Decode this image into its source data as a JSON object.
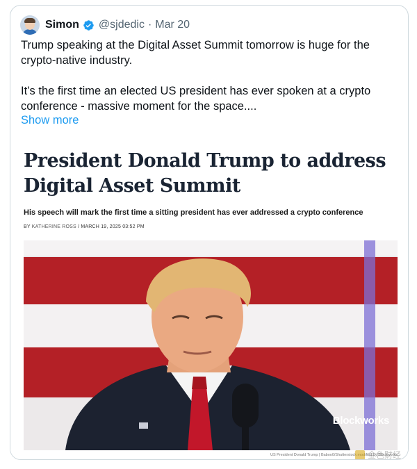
{
  "tweet": {
    "author_name": "Simon",
    "handle": "@sjdedic",
    "separator": "·",
    "date": "Mar 20",
    "paragraphs": [
      "Trump speaking at the Digital Asset Summit tomorrow is huge for the crypto-native industry.",
      "It’s the first time an elected US president has ever spoken at a crypto conference - massive moment for the space...."
    ],
    "show_more": "Show more"
  },
  "article": {
    "title": "President Donald Trump to address Digital Asset Summit",
    "subtitle": "His speech will mark the first time a sitting president has ever addressed a crypto conference",
    "byline_prefix": "BY",
    "author": "KATHERINE ROSS",
    "byline_sep": "/",
    "timestamp": "MARCH 19, 2025 03:52 PM",
    "photo_watermark": "Blockworks",
    "photo_caption": "US President Donald Trump | Baboo0/Shutterstock modified by Blockworks",
    "corner_logo_text": "金色财经"
  },
  "colors": {
    "link_blue": "#1d9bf0",
    "verified_blue": "#1d9bf0",
    "text_primary": "#0f1419",
    "text_secondary": "#536471",
    "flag_red": "#b42026",
    "flag_white": "#f3f1f2"
  },
  "icons": {
    "verified": "verified-badge-icon",
    "avatar": "avatar-image"
  }
}
